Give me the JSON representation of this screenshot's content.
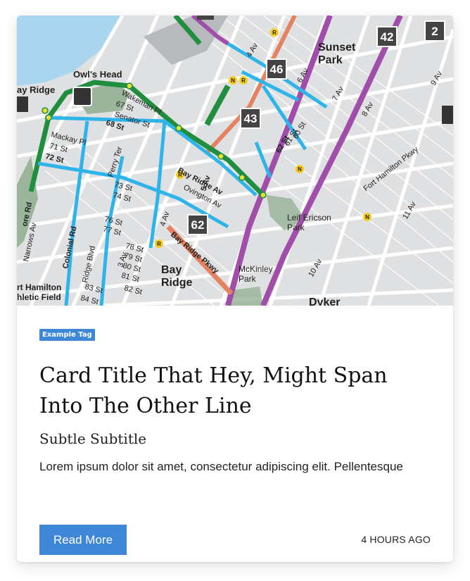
{
  "card": {
    "tag": "Example Tag",
    "title": "Card Title That Hey, Might Span Into The Other Line",
    "subtitle": "Subtle Subtitle",
    "description": "Lorem ipsum dolor sit amet, consectetur adipiscing elit. Pellentesque",
    "button_label": "Read More",
    "timestamp": "4 HOURS AGO"
  },
  "map": {
    "neighborhoods": [
      "Sunset Park",
      "Bay Ridge",
      "Owl's Head",
      "Dyker"
    ],
    "neighborhood_parts": {
      "sunset_1": "Sunset",
      "sunset_2": "Park",
      "bay_1": "Bay",
      "bay_2": "Ridge",
      "owls_1": "Owl's Head",
      "owls_2": "Park",
      "dyker": "Dyker",
      "ridge_left": "ay Ridge",
      "hamilton_1": "rt Hamilton",
      "hamilton_2": "hletic Field"
    },
    "parks": {
      "leif_1": "Leif Ericson",
      "leif_2": "Park",
      "mckinley_1": "McKinley",
      "mckinley_2": "Park"
    },
    "route_badges": [
      "42",
      "2",
      "46",
      "43",
      "62"
    ],
    "streets": {
      "av4": "4 Av",
      "av5": "5 Av",
      "av6": "6 Av",
      "av7": "7 Av",
      "av8": "8 Av",
      "av9": "9 Av",
      "av10": "10 Av",
      "av11": "11 Av",
      "av3": "3 Av",
      "st67": "67 St",
      "st68": "68 St",
      "st71": "71 St",
      "st72": "72 St",
      "st73": "73 St",
      "st74": "74 St",
      "st76": "76 St",
      "st77": "77 St",
      "st78": "78 St",
      "st79": "79 St",
      "st80": "80 St",
      "st81": "81 St",
      "st82": "82 St",
      "st83": "83 St",
      "st84": "84 St",
      "st60": "60 St",
      "st61": "61 St",
      "st62": "62 St",
      "senator": "Senator St",
      "mackay": "Mackay Pl",
      "wakeman": "Wakeman Pl",
      "perry": "Perry Ter",
      "ovington": "Ovington Av",
      "bay_ridge_av": "Bay Ridge Av",
      "bay_ridge_pkwy": "Bay Ridge Pkwy",
      "fort_hamilton": "Fort Hamilton Pkwy",
      "colonial": "Colonial Rd",
      "ridge_blvd": "Ridge Blvd",
      "narrows": "Narrows Av",
      "shore": "ore Rd"
    },
    "subway_lines": [
      "N",
      "R"
    ],
    "colors": {
      "bus_blue": "#2fb4ea",
      "subway_green": "#1f8f3f",
      "subway_purple": "#a04ea9",
      "subway_orange": "#e58260",
      "water": "#a9d5ee",
      "park": "#9ab59a",
      "land": "#dfe0e2"
    }
  }
}
